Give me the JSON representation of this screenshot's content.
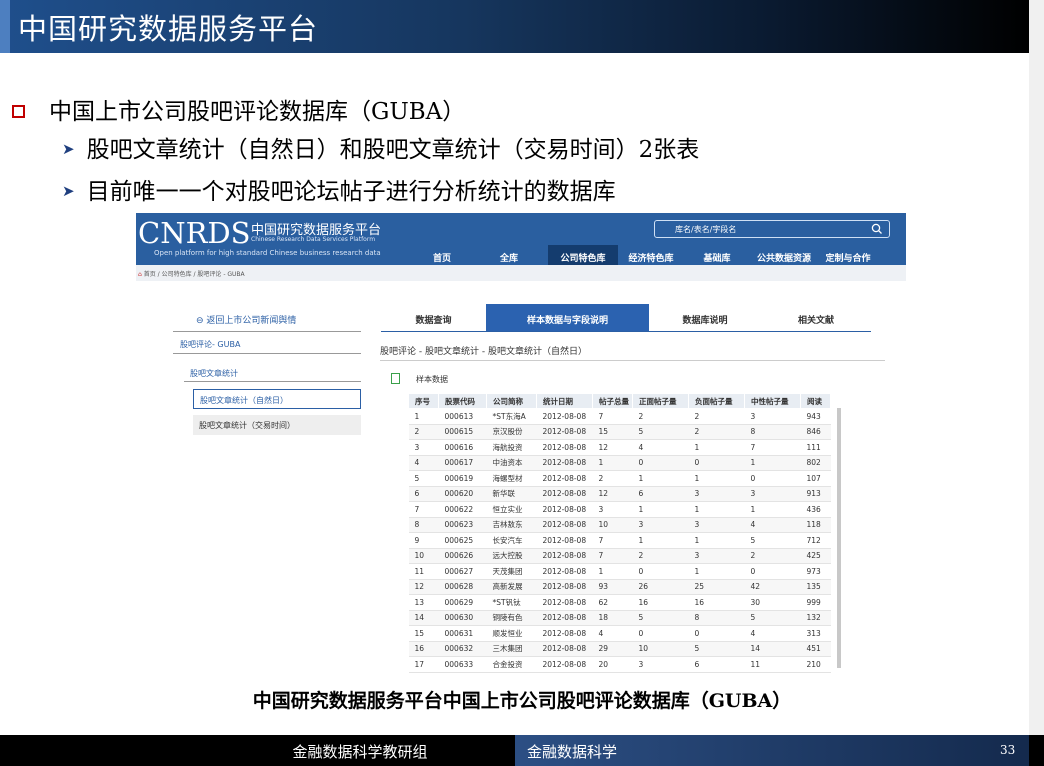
{
  "slide": {
    "title": "中国研究数据服务平台",
    "bullet1": "中国上市公司股吧评论数据库（GUBA）",
    "bullet2": "股吧文章统计（自然日）和股吧文章统计（交易时间）2张表",
    "bullet3": "目前唯一一个对股吧论坛帖子进行分析统计的数据库",
    "caption": "中国研究数据服务平台中国上市公司股吧评论数据库（GUBA）",
    "footer_left": "金融数据科学教研组",
    "footer_mid": "金融数据科学",
    "page": "33"
  },
  "site": {
    "logo": "CNRDS",
    "name_cn": "中国研究数据服务平台",
    "name_en": "Chinese Research Data Services Platform",
    "tagline": "Open platform for high standard Chinese business research data",
    "search_placeholder": "库名/表名/字段名",
    "nav": [
      "首页",
      "全库",
      "公司特色库",
      "经济特色库",
      "基础库",
      "公共数据资源",
      "定制与合作"
    ],
    "crumb_home": "首页",
    "crumb_rest": " / 公司特色库 / 股吧评论 - GUBA",
    "back_link": "返回上市公司新闻舆情",
    "side_db": "股吧评论- GUBA",
    "side_group": "股吧文章统计",
    "side_sel": "股吧文章统计（自然日）",
    "side_other": "股吧文章统计（交易时间）",
    "tabs": [
      "数据查询",
      "样本数据与字段说明",
      "数据库说明",
      "相关文献"
    ],
    "path": "股吧评论 - 股吧文章统计 - 股吧文章统计（自然日）",
    "sample_label": "样本数据"
  },
  "table": {
    "headers": [
      "序号",
      "股票代码",
      "公司简称",
      "统计日期",
      "帖子总量",
      "正面帖子量",
      "负面帖子量",
      "中性帖子量",
      "阅读"
    ],
    "rows": [
      [
        "1",
        "000613",
        "*ST东海A",
        "2012-08-08",
        "7",
        "2",
        "2",
        "3",
        "943"
      ],
      [
        "2",
        "000615",
        "京汉股份",
        "2012-08-08",
        "15",
        "5",
        "2",
        "8",
        "846"
      ],
      [
        "3",
        "000616",
        "海航投资",
        "2012-08-08",
        "12",
        "4",
        "1",
        "7",
        "111"
      ],
      [
        "4",
        "000617",
        "中油资本",
        "2012-08-08",
        "1",
        "0",
        "0",
        "1",
        "802"
      ],
      [
        "5",
        "000619",
        "海螺型材",
        "2012-08-08",
        "2",
        "1",
        "1",
        "0",
        "107"
      ],
      [
        "6",
        "000620",
        "新华联",
        "2012-08-08",
        "12",
        "6",
        "3",
        "3",
        "913"
      ],
      [
        "7",
        "000622",
        "恒立实业",
        "2012-08-08",
        "3",
        "1",
        "1",
        "1",
        "436"
      ],
      [
        "8",
        "000623",
        "吉林敖东",
        "2012-08-08",
        "10",
        "3",
        "3",
        "4",
        "118"
      ],
      [
        "9",
        "000625",
        "长安汽车",
        "2012-08-08",
        "7",
        "1",
        "1",
        "5",
        "712"
      ],
      [
        "10",
        "000626",
        "远大控股",
        "2012-08-08",
        "7",
        "2",
        "3",
        "2",
        "425"
      ],
      [
        "11",
        "000627",
        "天茂集团",
        "2012-08-08",
        "1",
        "0",
        "1",
        "0",
        "973"
      ],
      [
        "12",
        "000628",
        "高新发展",
        "2012-08-08",
        "93",
        "26",
        "25",
        "42",
        "135"
      ],
      [
        "13",
        "000629",
        "*ST钒钛",
        "2012-08-08",
        "62",
        "16",
        "16",
        "30",
        "999"
      ],
      [
        "14",
        "000630",
        "铜陵有色",
        "2012-08-08",
        "18",
        "5",
        "8",
        "5",
        "132"
      ],
      [
        "15",
        "000631",
        "顺发恒业",
        "2012-08-08",
        "4",
        "0",
        "0",
        "4",
        "313"
      ],
      [
        "16",
        "000632",
        "三木集团",
        "2012-08-08",
        "29",
        "10",
        "5",
        "14",
        "451"
      ],
      [
        "17",
        "000633",
        "合金投资",
        "2012-08-08",
        "20",
        "3",
        "6",
        "11",
        "210"
      ]
    ]
  }
}
